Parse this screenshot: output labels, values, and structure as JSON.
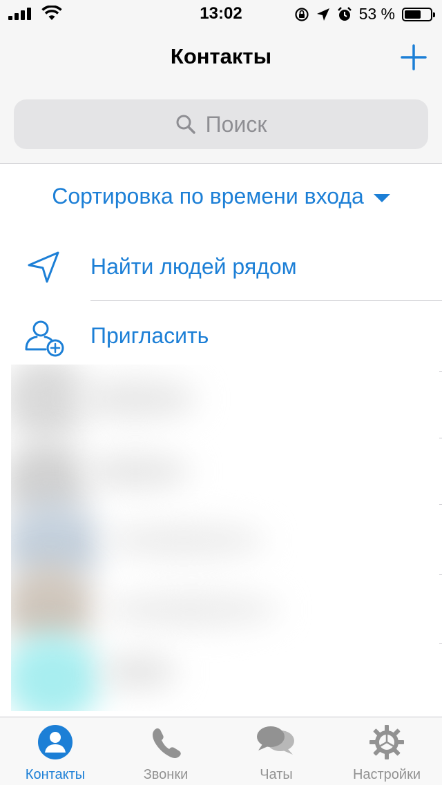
{
  "status_bar": {
    "time": "13:02",
    "battery": "53 %",
    "battery_level": 0.53
  },
  "nav": {
    "title": "Контакты"
  },
  "search": {
    "placeholder": "Поиск"
  },
  "sort": {
    "label": "Сортировка по времени входа"
  },
  "actions": [
    {
      "label": "Найти людей рядом",
      "icon": "location-arrow-icon"
    },
    {
      "label": "Пригласить",
      "icon": "add-person-icon"
    }
  ],
  "tabs": [
    {
      "label": "Контакты",
      "icon": "contacts-icon",
      "active": true
    },
    {
      "label": "Звонки",
      "icon": "phone-icon",
      "active": false
    },
    {
      "label": "Чаты",
      "icon": "chat-bubbles-icon",
      "active": false
    },
    {
      "label": "Настройки",
      "icon": "gear-icon",
      "active": false
    }
  ],
  "colors": {
    "accent": "#1c7fd6",
    "inactive": "#929292",
    "bar_bg": "#f6f6f6"
  }
}
